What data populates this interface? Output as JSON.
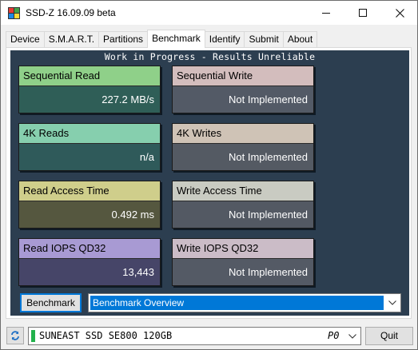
{
  "window": {
    "title": "SSD-Z 16.09.09 beta",
    "icon": "ssd-z-app-icon",
    "icon_colors": [
      "#e53935",
      "#43a047",
      "#1e88e5",
      "#fdd835"
    ]
  },
  "tabs": [
    {
      "label": "Device",
      "active": false
    },
    {
      "label": "S.M.A.R.T.",
      "active": false
    },
    {
      "label": "Partitions",
      "active": false
    },
    {
      "label": "Benchmark",
      "active": true
    },
    {
      "label": "Identify",
      "active": false
    },
    {
      "label": "Submit",
      "active": false
    },
    {
      "label": "About",
      "active": false
    }
  ],
  "benchmark": {
    "banner": "Work in Progress - Results Unreliable",
    "cards": {
      "seq_read": {
        "label": "Sequential Read",
        "value": "227.2 MB/s"
      },
      "seq_write": {
        "label": "Sequential Write",
        "value": "Not Implemented"
      },
      "k4_read": {
        "label": "4K Reads",
        "value": "n/a"
      },
      "k4_write": {
        "label": "4K Writes",
        "value": "Not Implemented"
      },
      "read_access": {
        "label": "Read Access Time",
        "value": "0.492 ms"
      },
      "write_access": {
        "label": "Write Access Time",
        "value": "Not Implemented"
      },
      "read_iops": {
        "label": "Read IOPS QD32",
        "value": "13,443"
      },
      "write_iops": {
        "label": "Write IOPS QD32",
        "value": "Not Implemented"
      }
    },
    "run_button": "Benchmark",
    "mode_select": "Benchmark Overview"
  },
  "footer": {
    "drive_name": "SUNEAST SSD SE800 120GB",
    "drive_port": "P0",
    "quit_button": "Quit"
  },
  "colors": {
    "panel_bg": "#2c3e50",
    "selection": "#0078d7",
    "drive_indicator": "#22b14c"
  }
}
